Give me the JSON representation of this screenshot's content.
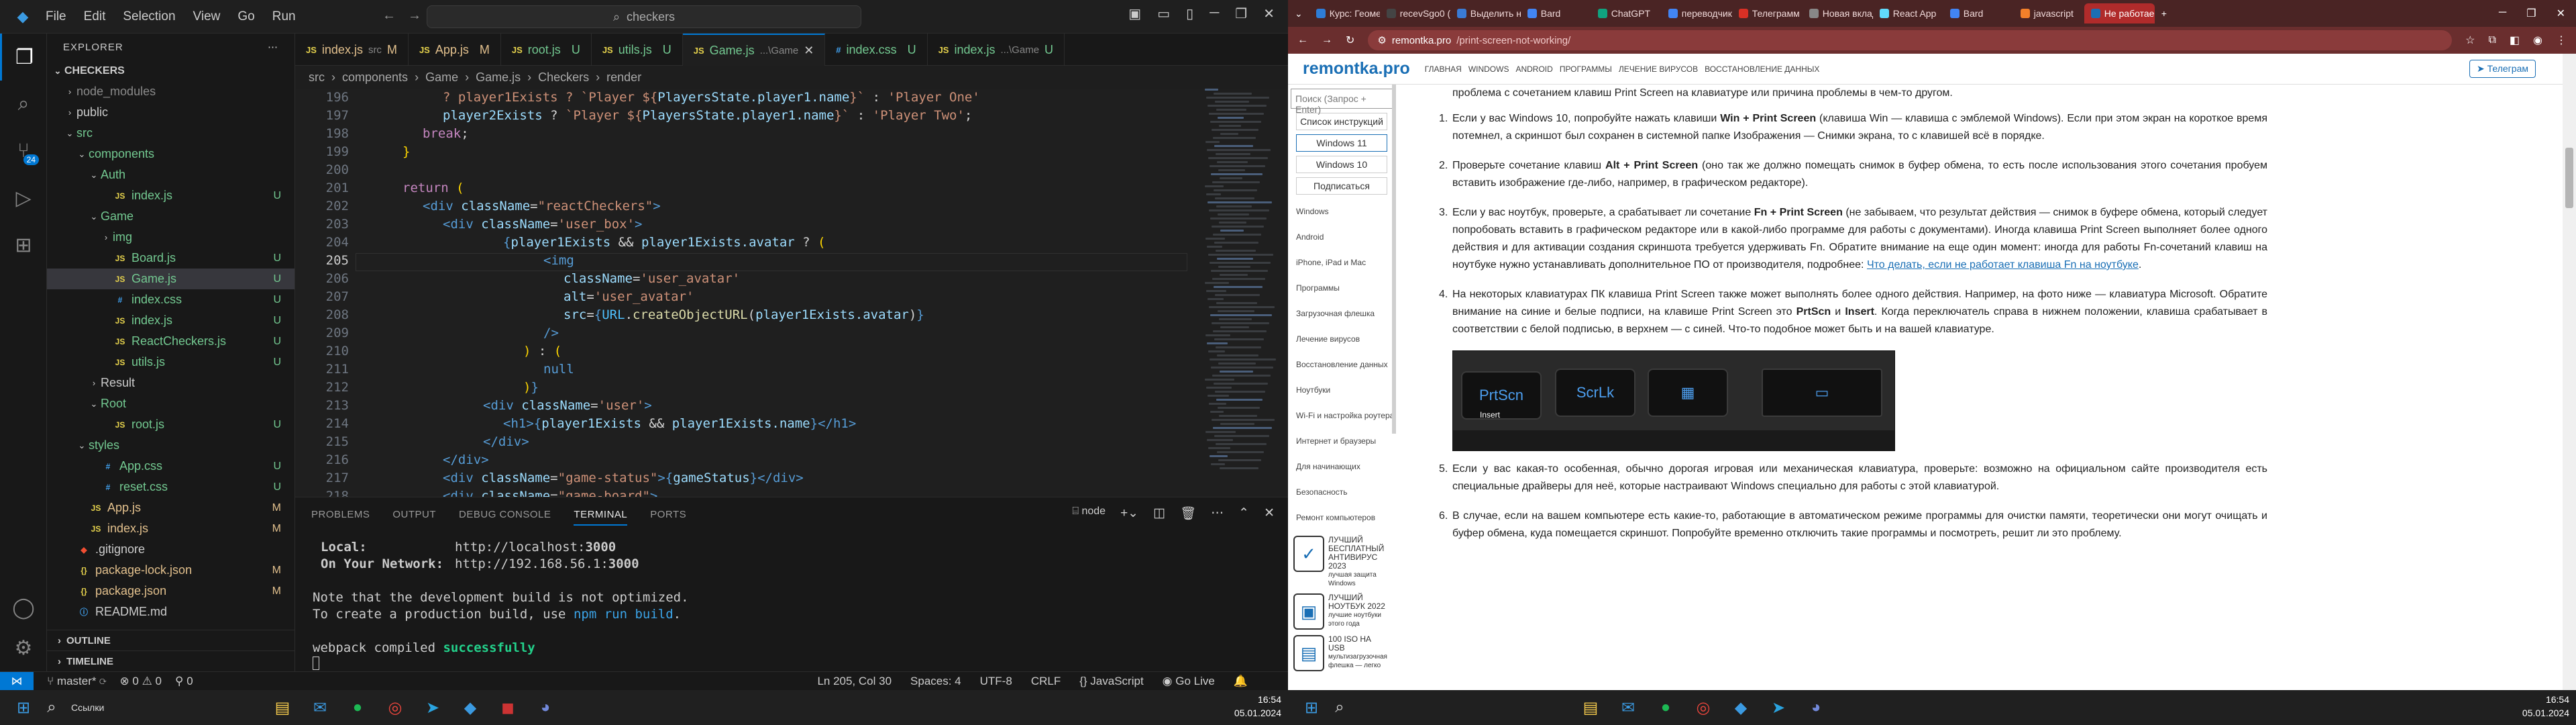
{
  "vscode": {
    "menu": [
      "File",
      "Edit",
      "Selection",
      "View",
      "Go",
      "Run"
    ],
    "search": "checkers",
    "explorer_title": "EXPLORER",
    "root": "CHECKERS",
    "tree": [
      {
        "label": "node_modules",
        "depth": 1,
        "type": "folder",
        "open": false,
        "status": "",
        "color": "#8b8b8b"
      },
      {
        "label": "public",
        "depth": 1,
        "type": "folder",
        "open": false,
        "status": "",
        "color": "#ccc"
      },
      {
        "label": "src",
        "depth": 1,
        "type": "folder",
        "open": true,
        "status": "",
        "color": "#73c991"
      },
      {
        "label": "components",
        "depth": 2,
        "type": "folder",
        "open": true,
        "status": "",
        "color": "#73c991"
      },
      {
        "label": "Auth",
        "depth": 3,
        "type": "folder",
        "open": true,
        "status": "",
        "color": "#73c991"
      },
      {
        "label": "index.js",
        "depth": 4,
        "type": "js",
        "status": "U",
        "color": "#73c991"
      },
      {
        "label": "Game",
        "depth": 3,
        "type": "folder",
        "open": true,
        "status": "",
        "color": "#73c991"
      },
      {
        "label": "img",
        "depth": 4,
        "type": "folder",
        "open": false,
        "status": "",
        "color": "#73c991"
      },
      {
        "label": "Board.js",
        "depth": 4,
        "type": "js",
        "status": "U",
        "color": "#73c991"
      },
      {
        "label": "Game.js",
        "depth": 4,
        "type": "js",
        "status": "U",
        "color": "#73c991",
        "selected": true
      },
      {
        "label": "index.css",
        "depth": 4,
        "type": "css",
        "status": "U",
        "color": "#73c991"
      },
      {
        "label": "index.js",
        "depth": 4,
        "type": "js",
        "status": "U",
        "color": "#73c991"
      },
      {
        "label": "ReactCheckers.js",
        "depth": 4,
        "type": "js",
        "status": "U",
        "color": "#73c991"
      },
      {
        "label": "utils.js",
        "depth": 4,
        "type": "js",
        "status": "U",
        "color": "#73c991"
      },
      {
        "label": "Result",
        "depth": 3,
        "type": "folder",
        "open": false,
        "status": "",
        "color": "#ccc"
      },
      {
        "label": "Root",
        "depth": 3,
        "type": "folder",
        "open": true,
        "status": "",
        "color": "#73c991"
      },
      {
        "label": "root.js",
        "depth": 4,
        "type": "js",
        "status": "U",
        "color": "#73c991"
      },
      {
        "label": "styles",
        "depth": 2,
        "type": "folder",
        "open": true,
        "status": "",
        "color": "#73c991"
      },
      {
        "label": "App.css",
        "depth": 3,
        "type": "css",
        "status": "U",
        "color": "#73c991"
      },
      {
        "label": "reset.css",
        "depth": 3,
        "type": "css",
        "status": "U",
        "color": "#73c991"
      },
      {
        "label": "App.js",
        "depth": 2,
        "type": "js",
        "status": "M",
        "color": "#e2c08d"
      },
      {
        "label": "index.js",
        "depth": 2,
        "type": "js",
        "status": "M",
        "color": "#e2c08d"
      },
      {
        "label": ".gitignore",
        "depth": 1,
        "type": "git",
        "status": "",
        "color": "#ccc"
      },
      {
        "label": "package-lock.json",
        "depth": 1,
        "type": "json",
        "status": "M",
        "color": "#e2c08d"
      },
      {
        "label": "package.json",
        "depth": 1,
        "type": "json",
        "status": "M",
        "color": "#e2c08d"
      },
      {
        "label": "README.md",
        "depth": 1,
        "type": "md",
        "status": "",
        "color": "#ccc"
      }
    ],
    "outline": "OUTLINE",
    "timeline": "TIMELINE",
    "tabs": [
      {
        "label": "index.js",
        "dir": "src",
        "status": "M",
        "color": "#e2c08d"
      },
      {
        "label": "App.js",
        "dir": "",
        "status": "M",
        "color": "#e2c08d"
      },
      {
        "label": "root.js",
        "dir": "",
        "status": "U",
        "color": "#73c991"
      },
      {
        "label": "utils.js",
        "dir": "",
        "status": "U",
        "color": "#73c991"
      },
      {
        "label": "Game.js",
        "dir": "...\\Game",
        "status": "U",
        "color": "#73c991",
        "active": true
      },
      {
        "label": "index.css",
        "dir": "",
        "status": "U",
        "color": "#73c991"
      },
      {
        "label": "index.js",
        "dir": "...\\Game",
        "status": "U",
        "color": "#73c991"
      }
    ],
    "breadcrumbs": [
      "src",
      "components",
      "Game",
      "Game.js",
      "Checkers",
      "render"
    ],
    "current_line": "205",
    "panel_tabs": [
      "PROBLEMS",
      "OUTPUT",
      "DEBUG CONSOLE",
      "TERMINAL",
      "PORTS"
    ],
    "terminal_label": "node",
    "terminal": {
      "local_label": "Local:",
      "local_url": "http://localhost:",
      "local_port": "3000",
      "net_label": "On Your Network:",
      "net_url": "http://192.168.56.1:",
      "net_port": "3000",
      "note1": "Note that the development build is not optimized.",
      "note2a": "To create a production build, use ",
      "note2b": "npm run build",
      ".": ".",
      "compiled_a": "webpack compiled ",
      "compiled_b": "successfully"
    },
    "status": {
      "branch": "master*",
      "sync": "⟳",
      "errors": "⊗ 0 ⚠ 0",
      "ports": "⚲ 0",
      "pos": "Ln 205, Col 30",
      "spaces": "Spaces: 4",
      "enc": "UTF-8",
      "eol": "CRLF",
      "lang": "{} JavaScript",
      "live": "Go Live"
    },
    "task_search": "Ссылки",
    "time": "16:54",
    "date": "05.01.2024"
  },
  "browser": {
    "tabs": [
      {
        "label": "Курс: Геоме",
        "color": "#2e7dd7"
      },
      {
        "label": "recevSgo0 (1)",
        "color": "#444"
      },
      {
        "label": "Выделить не",
        "color": "#3a7bd5"
      },
      {
        "label": "Bard",
        "color": "#4285f4"
      },
      {
        "label": "ChatGPT",
        "color": "#10a37f"
      },
      {
        "label": "переводчик",
        "color": "#4285f4"
      },
      {
        "label": "Телеграмм",
        "color": "#d93025"
      },
      {
        "label": "Новая вклад",
        "color": "#888"
      },
      {
        "label": "React App",
        "color": "#61dafb"
      },
      {
        "label": "Bard",
        "color": "#4285f4"
      },
      {
        "label": "javascript",
        "color": "#f4802a"
      },
      {
        "label": "Не работае",
        "color": "#1a6fb5",
        "active": true
      }
    ],
    "url_domain": "remontka.pro",
    "url_path": "/print-screen-not-working/",
    "logo": "remontka.pro",
    "nav": [
      "ГЛАВНАЯ",
      "WINDOWS",
      "ANDROID",
      "ПРОГРАММЫ",
      "ЛЕЧЕНИЕ ВИРУСОВ",
      "ВОССТАНОВЛЕНИЕ ДАННЫХ"
    ],
    "telegram": "Телеграм",
    "search_placeholder": "Поиск (Запрос + Enter)",
    "left_buttons": [
      "Список инструкций",
      "Windows 11",
      "Windows 10",
      "Подписаться"
    ],
    "left_items": [
      "Windows",
      "Android",
      "iPhone, iPad и Mac",
      "Программы",
      "Загрузочная флешка",
      "Лечение вирусов",
      "Восстановление данных",
      "Ноутбуки",
      "Wi-Fi и настройка роутера",
      "Интернет и браузеры",
      "Для начинающих",
      "Безопасность",
      "Ремонт компьютеров"
    ],
    "ads": [
      {
        "title": "ЛУЧШИЙ БЕСПЛАТНЫЙ АНТИВИРУС 2023",
        "sub": "лучшая защита Windows",
        "icon": "✓"
      },
      {
        "title": "ЛУЧШИЙ НОУТБУК 2022",
        "sub": "лучшие ноутбуки этого года",
        "icon": "▣"
      },
      {
        "title": "100 ISO НА USB",
        "sub": "мультизагрузочная флешка — легко",
        "icon": "▤"
      }
    ],
    "intro": "проблема с сочетанием клавиш Print Screen на клавиатуре или причина проблемы в чем-то другом.",
    "items": [
      {
        "n": "1.",
        "html": "Если у вас Windows 10, попробуйте нажать клавиши <b>Win + Print Screen</b> (клавиша Win — клавиша с эмблемой Windows). Если при этом экран на короткое время потемнел, а скриншот был сохранен в системной папке Изображения — Снимки экрана, то с клавишей всё в порядке."
      },
      {
        "n": "2.",
        "html": "Проверьте сочетание клавиш <b>Alt + Print Screen</b> (оно так же должно помещать снимок в буфер обмена, то есть после использования этого сочетания пробуем вставить изображение где-либо, например, в графическом редакторе)."
      },
      {
        "n": "3.",
        "html": "Если у вас ноутбук, проверьте, а срабатывает ли сочетание <b>Fn + Print Screen</b> (не забываем, что результат действия — снимок в буфере обмена, который следует попробовать вставить в графическом редакторе или в какой-либо программе для работы с документами). Иногда клавиша Print Screen выполняет более одного действия и для активации создания скриншота требуется удерживать Fn. Обратите внимание на еще один момент: иногда для работы Fn-сочетаний клавиш на ноутбуке нужно устанавливать дополнительное ПО от производителя, подробнее: <a>Что делать, если не работает клавиша Fn на ноутбуке</a>."
      },
      {
        "n": "4.",
        "html": "На некоторых клавиатурах ПК клавиша Print Screen также может выполнять более одного действия. Например, на фото ниже — клавиатура Microsoft. Обратите внимание на синие и белые подписи, на клавише Print Screen это <b>PrtScn</b> и <b>Insert</b>. Когда переключатель справа в нижнем положении, клавиша срабатывает в соответствии с белой подписью, в верхнем — с синей. Что-то подобное может быть и на вашей клавиатуре."
      }
    ],
    "img_keys": [
      "PrtScn",
      "ScrLk",
      "Insert"
    ],
    "items2": [
      {
        "n": "5.",
        "html": "Если у вас какая-то особенная, обычно дорогая игровая или механическая клавиатура, проверьте: возможно на официальном сайте производителя есть специальные драйверы для неё, которые настраивают Windows специально для работы с этой клавиатурой."
      },
      {
        "n": "6.",
        "html": "В случае, если на вашем компьютере есть какие-то, работающие в автоматическом режиме программы для очистки памяти, теоретически они могут очищать и буфер обмена, куда помещается скриншот. Попробуйте временно отключить такие программы и посмотреть, решит ли это проблему."
      }
    ]
  }
}
